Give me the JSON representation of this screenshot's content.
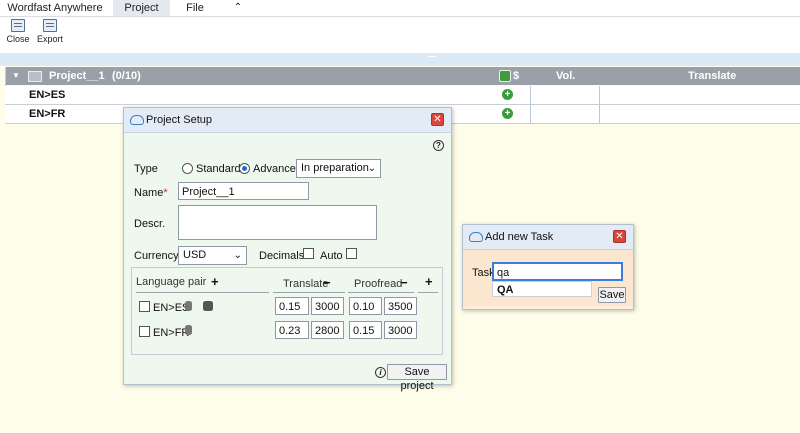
{
  "menubar": {
    "items": [
      "Wordfast Anywhere",
      "Project",
      "File"
    ],
    "collapse_icon": "double-chevron-up-icon"
  },
  "toolbar": {
    "close_label": "Close",
    "export_label": "Export"
  },
  "grid": {
    "project_title": "Project__1",
    "project_count": "(0/10)",
    "dollar": "$",
    "col_vol": "Vol.",
    "col_translate": "Translate",
    "rows": [
      "EN>ES",
      "EN>FR"
    ]
  },
  "project_setup": {
    "title": "Project Setup",
    "help": "?",
    "type_label": "Type",
    "type_standard": "Standard",
    "type_advanced": "Advanced",
    "type_selected": "Advanced",
    "status_value": "In preparation",
    "name_label": "Name",
    "required_mark": "*",
    "name_value": "Project__1",
    "descr_label": "Descr.",
    "currency_label": "Currency",
    "currency_value": "USD",
    "decimals_label": "Decimals",
    "auto_label": "Auto",
    "table": {
      "col_language_pair": "Language pair",
      "col_translate": "Translate",
      "col_proofread": "Proofread",
      "plus": "+",
      "minus": "−",
      "rows": [
        {
          "pair": "EN>ES",
          "tr_rate": "0.15",
          "tr_vol": "3000",
          "pr_rate": "0.10",
          "pr_vol": "3500"
        },
        {
          "pair": "EN>FR",
          "tr_rate": "0.23",
          "tr_vol": "2800",
          "pr_rate": "0.15",
          "pr_vol": "3000"
        }
      ]
    },
    "info": "i",
    "save_label": "Save project"
  },
  "add_task": {
    "title": "Add new Task",
    "task_label": "Task",
    "task_value": "qa",
    "suggestion": "QA",
    "save_label": "Save"
  },
  "colors": {
    "page_bg": "#fdfde9",
    "grid_header": "#9aa0a8",
    "dialog_bg": "#eef8ee",
    "task_bg": "#fbe6cf",
    "close_red": "#d9463a"
  }
}
